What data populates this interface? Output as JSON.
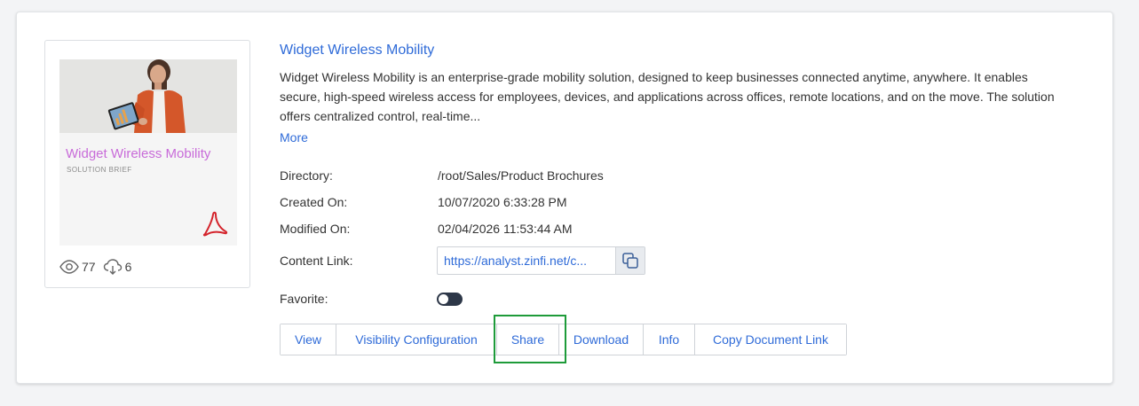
{
  "asset": {
    "title": "Widget Wireless Mobility",
    "description": "Widget Wireless Mobility is an enterprise-grade mobility solution, designed to keep businesses connected anytime, anywhere. It enables secure, high-speed wireless access for employees, devices, and applications across offices, remote locations, and on the move. The solution offers centralized control, real-time...",
    "more_label": "More"
  },
  "thumbnail": {
    "title": "Widget Wireless Mobility",
    "subtitle": "SOLUTION BRIEF",
    "file_icon": "pdf-icon"
  },
  "stats": {
    "views": "77",
    "downloads": "6",
    "views_icon": "eye-icon",
    "downloads_icon": "cloud-download-icon"
  },
  "details": {
    "directory_label": "Directory:",
    "directory_value": "/root/Sales/Product Brochures",
    "created_label": "Created On:",
    "created_value": "10/07/2020 6:33:28 PM",
    "modified_label": "Modified On:",
    "modified_value": "02/04/2026 11:53:44 AM",
    "content_link_label": "Content Link:",
    "content_link_value": "https://analyst.zinfi.net/c...",
    "favorite_label": "Favorite:",
    "favorite_on": false
  },
  "actions": {
    "view": "View",
    "visibility": "Visibility Configuration",
    "share": "Share",
    "download": "Download",
    "info": "Info",
    "copy_link": "Copy Document Link"
  },
  "colors": {
    "accent": "#2f6bd8",
    "highlight": "#1e9b3a",
    "thumbnail_title": "#c86bd9",
    "toggle": "#2d3748"
  }
}
